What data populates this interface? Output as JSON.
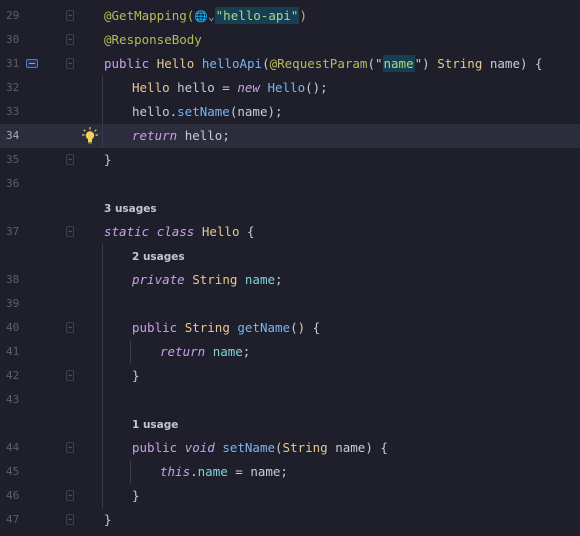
{
  "editor": {
    "lines": [
      {
        "num": "29",
        "segments": [
          {
            "t": "@GetMapping(",
            "c": "anno"
          },
          {
            "t": "🌐⌄",
            "c": "ico-web"
          },
          {
            "t": "\"hello-api\"",
            "c": "strhl"
          },
          {
            "t": ")",
            "c": "anno"
          }
        ]
      },
      {
        "num": "30",
        "segments": [
          {
            "t": "@ResponseBody",
            "c": "anno"
          }
        ]
      },
      {
        "num": "31",
        "segments": [
          {
            "t": "public ",
            "c": "kwn"
          },
          {
            "t": "Hello ",
            "c": "type"
          },
          {
            "t": "helloApi",
            "c": "fn"
          },
          {
            "t": "(",
            "c": "punc"
          },
          {
            "t": "@RequestParam",
            "c": "anno"
          },
          {
            "t": "(\"",
            "c": "punc"
          },
          {
            "t": "name",
            "c": "strhl"
          },
          {
            "t": "\") ",
            "c": "punc"
          },
          {
            "t": "String ",
            "c": "type"
          },
          {
            "t": "name",
            "c": "param"
          },
          {
            "t": ") {",
            "c": "punc"
          }
        ]
      },
      {
        "num": "32",
        "segments": [
          {
            "t": "Hello ",
            "c": "type"
          },
          {
            "t": "hello = ",
            "c": "punc"
          },
          {
            "t": "new ",
            "c": "kw"
          },
          {
            "t": "Hello",
            "c": "fn"
          },
          {
            "t": "();",
            "c": "punc"
          }
        ]
      },
      {
        "num": "33",
        "segments": [
          {
            "t": "hello.",
            "c": "punc"
          },
          {
            "t": "setName",
            "c": "fn"
          },
          {
            "t": "(name);",
            "c": "punc"
          }
        ]
      },
      {
        "num": "34",
        "segments": [
          {
            "t": "return ",
            "c": "kw"
          },
          {
            "t": "hello;",
            "c": "punc"
          }
        ]
      },
      {
        "num": "35",
        "segments": [
          {
            "t": "}",
            "c": "punc"
          }
        ]
      },
      {
        "num": "36",
        "segments": []
      },
      {
        "num": "",
        "segments": [
          {
            "t": "3 usages",
            "c": "usages"
          }
        ]
      },
      {
        "num": "37",
        "segments": [
          {
            "t": "static ",
            "c": "kw"
          },
          {
            "t": "class ",
            "c": "kw"
          },
          {
            "t": "Hello ",
            "c": "type"
          },
          {
            "t": "{",
            "c": "punc"
          }
        ]
      },
      {
        "num": "",
        "segments": [
          {
            "t": "2 usages",
            "c": "usages"
          }
        ]
      },
      {
        "num": "38",
        "segments": [
          {
            "t": "private ",
            "c": "kw"
          },
          {
            "t": "String ",
            "c": "type"
          },
          {
            "t": "name",
            "c": "field"
          },
          {
            "t": ";",
            "c": "punc"
          }
        ]
      },
      {
        "num": "39",
        "segments": []
      },
      {
        "num": "40",
        "segments": [
          {
            "t": "public ",
            "c": "kwn"
          },
          {
            "t": "String ",
            "c": "type"
          },
          {
            "t": "getName",
            "c": "fn"
          },
          {
            "t": "() {",
            "c": "punc"
          }
        ]
      },
      {
        "num": "41",
        "segments": [
          {
            "t": "return ",
            "c": "kw"
          },
          {
            "t": "name",
            "c": "field"
          },
          {
            "t": ";",
            "c": "punc"
          }
        ]
      },
      {
        "num": "42",
        "segments": [
          {
            "t": "}",
            "c": "punc"
          }
        ]
      },
      {
        "num": "43",
        "segments": []
      },
      {
        "num": "",
        "segments": [
          {
            "t": "1 usage",
            "c": "usages"
          }
        ]
      },
      {
        "num": "44",
        "segments": [
          {
            "t": "public ",
            "c": "kwn"
          },
          {
            "t": "void ",
            "c": "kw"
          },
          {
            "t": "setName",
            "c": "fn"
          },
          {
            "t": "(",
            "c": "punc"
          },
          {
            "t": "String ",
            "c": "type"
          },
          {
            "t": "name",
            "c": "param"
          },
          {
            "t": ") {",
            "c": "punc"
          }
        ]
      },
      {
        "num": "45",
        "segments": [
          {
            "t": "this",
            "c": "kw"
          },
          {
            "t": ".",
            "c": "punc"
          },
          {
            "t": "name",
            "c": "field"
          },
          {
            "t": " = name;",
            "c": "punc"
          }
        ]
      },
      {
        "num": "46",
        "segments": [
          {
            "t": "}",
            "c": "punc"
          }
        ]
      },
      {
        "num": "47",
        "segments": [
          {
            "t": "}",
            "c": "punc"
          }
        ]
      }
    ],
    "current_line": "34",
    "colors": {
      "background": "#1e1f2b",
      "current_line": "#2b2d3d",
      "annotation": "#b7ba58",
      "keyword": "#c9a0e8",
      "type": "#e8c88e",
      "function": "#7ab4ef",
      "string": "#a7d98a",
      "field": "#7fd3d6"
    },
    "icons": {
      "implementing_method": "method-gutter-icon",
      "intention": "lightbulb-icon",
      "web_endpoint": "globe-icon"
    }
  }
}
